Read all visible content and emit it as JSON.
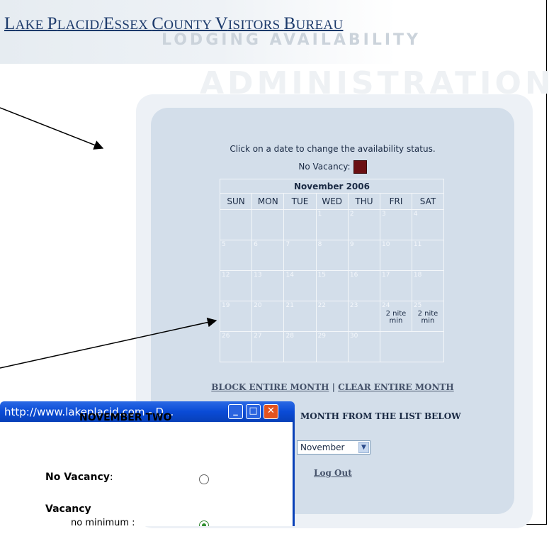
{
  "header": {
    "title_parts": [
      {
        "text": "L",
        "small": false
      },
      {
        "text": "AKE ",
        "small": true
      },
      {
        "text": "P",
        "small": false
      },
      {
        "text": "LACID/",
        "small": true
      },
      {
        "text": "E",
        "small": false
      },
      {
        "text": "SSEX ",
        "small": true
      },
      {
        "text": "C",
        "small": false
      },
      {
        "text": "OUNTY ",
        "small": true
      },
      {
        "text": "V",
        "small": false
      },
      {
        "text": "ISITORS ",
        "small": true
      },
      {
        "text": "B",
        "small": false
      },
      {
        "text": "UREAU",
        "small": true
      }
    ],
    "subtitle": "LODGING AVAILABILITY",
    "section_word": "ADMINISTRATION"
  },
  "instructions": "Click on a date to change the availability status.",
  "legend": {
    "label": "No Vacancy:",
    "color": "#6b0f12"
  },
  "calendar": {
    "title": "November 2006",
    "weekdays": [
      "SUN",
      "MON",
      "TUE",
      "WED",
      "THU",
      "FRI",
      "SAT"
    ],
    "weeks": [
      [
        null,
        null,
        null,
        {
          "day": "1"
        },
        {
          "day": "2"
        },
        {
          "day": "3"
        },
        {
          "day": "4"
        }
      ],
      [
        {
          "day": "5"
        },
        {
          "day": "6"
        },
        {
          "day": "7"
        },
        {
          "day": "8"
        },
        {
          "day": "9"
        },
        {
          "day": "10"
        },
        {
          "day": "11"
        }
      ],
      [
        {
          "day": "12"
        },
        {
          "day": "13"
        },
        {
          "day": "14"
        },
        {
          "day": "15"
        },
        {
          "day": "16"
        },
        {
          "day": "17"
        },
        {
          "day": "18"
        }
      ],
      [
        {
          "day": "19"
        },
        {
          "day": "20"
        },
        {
          "day": "21"
        },
        {
          "day": "22"
        },
        {
          "day": "23"
        },
        {
          "day": "24",
          "note": "2 nite min"
        },
        {
          "day": "25",
          "note": "2 nite min"
        }
      ],
      [
        {
          "day": "26"
        },
        {
          "day": "27"
        },
        {
          "day": "28"
        },
        {
          "day": "29"
        },
        {
          "day": "30"
        }
      ]
    ]
  },
  "actions": {
    "block_month": "BLOCK ENTIRE MONTH",
    "separator": "|",
    "clear_month": "CLEAR ENTIRE MONTH"
  },
  "month_selector": {
    "prompt": "MONTH FROM THE LIST BELOW",
    "selected": "November"
  },
  "logout": "Log Out",
  "popup": {
    "title": "http://www.lakeplacid.com - D...",
    "heading": "NOVEMBER  TWO",
    "no_vacancy_label": "No Vacancy",
    "colon": ":",
    "vacancy_label": "Vacancy",
    "no_minimum_label": "no minimum :",
    "no_vacancy_checked": false,
    "no_minimum_checked": true
  }
}
